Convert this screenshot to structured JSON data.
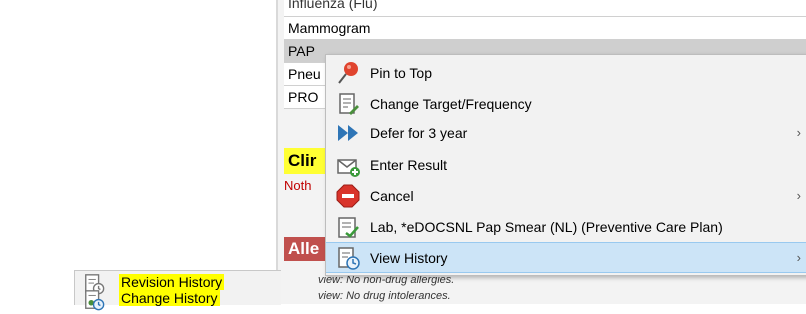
{
  "health_maintenance": {
    "rows": [
      "Influenza (Flu)",
      "Mammogram",
      "PAP",
      "Pneu",
      "PRO"
    ]
  },
  "sections": {
    "clinical_label": "Clir",
    "nothing_text": "Noth",
    "allergies_label": "Alle"
  },
  "allergy_lines": [
    "view: No non-drug allergies.",
    "view: No drug intolerances."
  ],
  "context_menu": {
    "items": [
      {
        "label": "Pin to Top",
        "icon": "pin-icon",
        "submenu": false
      },
      {
        "label": "Change Target/Frequency",
        "icon": "edit-document-icon",
        "submenu": false
      },
      {
        "label": "Defer for 3 year",
        "icon": "fast-forward-icon",
        "submenu": true
      },
      {
        "label": "Enter Result",
        "icon": "envelope-add-icon",
        "submenu": false
      },
      {
        "label": "Cancel",
        "icon": "stop-icon",
        "submenu": true
      },
      {
        "label": "Lab, *eDOCSNL Pap Smear (NL) (Preventive Care Plan)",
        "icon": "lab-order-icon",
        "submenu": false
      },
      {
        "label": "View History",
        "icon": "history-document-icon",
        "submenu": true,
        "highlighted": true
      }
    ]
  },
  "submenu": {
    "items": [
      {
        "label": "Revision History",
        "icon": "revision-history-icon",
        "highlighted_marker": "#ffff00"
      },
      {
        "label": "Change History",
        "icon": "change-history-icon",
        "highlighted_marker": "#ffff00"
      }
    ]
  },
  "colors": {
    "menu_highlight": "#cce4f7",
    "clinical_bg": "#ffff33",
    "allergies_bg": "#c0504d",
    "stop_red": "#d9342b",
    "defer_blue": "#2e75b6"
  }
}
